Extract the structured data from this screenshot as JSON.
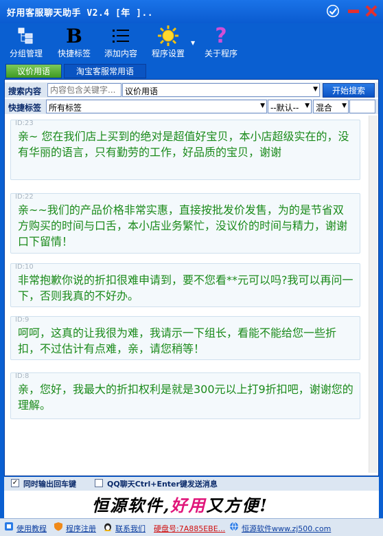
{
  "window": {
    "title": "好用客服聊天助手 V2.4 [年 ].."
  },
  "toolbar": {
    "items": [
      {
        "label": "分组管理",
        "icon": "group-icon"
      },
      {
        "label": "快捷标签",
        "icon": "bold-b-icon"
      },
      {
        "label": "添加内容",
        "icon": "list-icon"
      },
      {
        "label": "程序设置",
        "icon": "sun-gear-icon"
      },
      {
        "label": "关于程序",
        "icon": "question-icon"
      }
    ]
  },
  "tabs": [
    {
      "label": "议价用语",
      "active": true
    },
    {
      "label": "淘宝客服常用语",
      "active": false
    }
  ],
  "search": {
    "label": "搜索内容",
    "placeholder": "内容包含关键字...",
    "category_selected": "议价用语",
    "button": "开始搜索"
  },
  "tags": {
    "label": "快捷标签",
    "tag_selected": "所有标签",
    "sort_selected": "--默认--",
    "mode_selected": "混合"
  },
  "messages": [
    {
      "id": "ID:23",
      "text": "亲~ 您在我们店上买到的绝对是超值好宝贝，本小店超级实在的，没有华丽的语言，只有勤劳的工作，好品质的宝贝，谢谢"
    },
    {
      "id": "ID:22",
      "text": "亲~~我们的产品价格非常实惠，直接按批发价发售，为的是节省双方购买的时间与口舌，本小店业务繁忙，没议价的时间与精力，谢谢口下留情！"
    },
    {
      "id": "ID:10",
      "text": "非常抱歉你说的折扣很难申请到，要不您看**元可以吗?我可以再问一下，否则我真的不好办。"
    },
    {
      "id": "ID:9",
      "text": "呵呵，这真的让我很为难，我请示一下组长，看能不能给您一些折扣，不过估计有点难，亲，请您稍等！"
    },
    {
      "id": "ID:8",
      "text": "亲，您好，我最大的折扣权利是就是300元以上打9折扣吧，谢谢您的理解。"
    }
  ],
  "options": {
    "enter_output": {
      "label": "同时输出回车键",
      "checked": true
    },
    "qq_send": {
      "label": "QQ聊天Ctrl+Enter键发送消息",
      "checked": false
    }
  },
  "slogan": {
    "part1": "恒源软件,",
    "part2": "好用",
    "part3": "又方便!"
  },
  "statusbar": {
    "items": [
      {
        "label": "使用教程"
      },
      {
        "label": "程序注册"
      },
      {
        "label": "联系我们"
      },
      {
        "label": "硬盘号:7A885EBE..."
      },
      {
        "label": "恒源软件www.zj500.com"
      }
    ]
  },
  "colors": {
    "frame_blue": "#0a5fd1",
    "message_green": "#1a8a1a",
    "slogan_pink": "#e0157a"
  }
}
